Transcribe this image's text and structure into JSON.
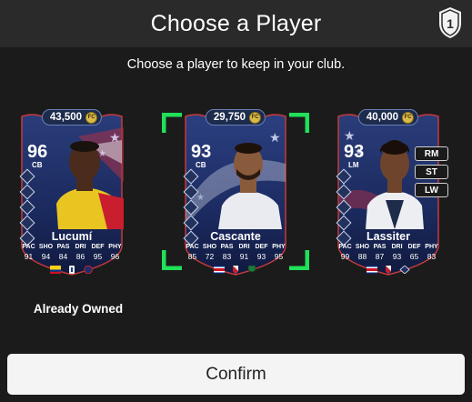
{
  "header": {
    "title": "Choose a Player",
    "badge_icon": "one-loan-badge-icon"
  },
  "subtitle": "Choose a player to keep in your club.",
  "stat_labels": [
    "PAC",
    "SHO",
    "PAS",
    "DRI",
    "DEF",
    "PHY"
  ],
  "cards": [
    {
      "price": "43,500",
      "rating": "96",
      "position": "CB",
      "name": "Lucumí",
      "stats": [
        "91",
        "94",
        "84",
        "86",
        "95",
        "96"
      ],
      "status": "Already Owned",
      "selected": false
    },
    {
      "price": "29,750",
      "rating": "93",
      "position": "CB",
      "name": "Cascante",
      "stats": [
        "85",
        "72",
        "83",
        "91",
        "93",
        "95"
      ],
      "selected": true
    },
    {
      "price": "40,000",
      "rating": "93",
      "position": "LM",
      "name": "Lassiter",
      "stats": [
        "99",
        "88",
        "87",
        "93",
        "65",
        "83"
      ],
      "alt_positions": [
        "RM",
        "ST",
        "LW"
      ],
      "selected": false
    }
  ],
  "confirm_label": "Confirm",
  "colors": {
    "background": "#1b1b1b",
    "header": "#2a2a2a",
    "selection_green": "#21e05a",
    "card_navy": "#1e2f63",
    "confirm_button": "#f4f4f4"
  }
}
